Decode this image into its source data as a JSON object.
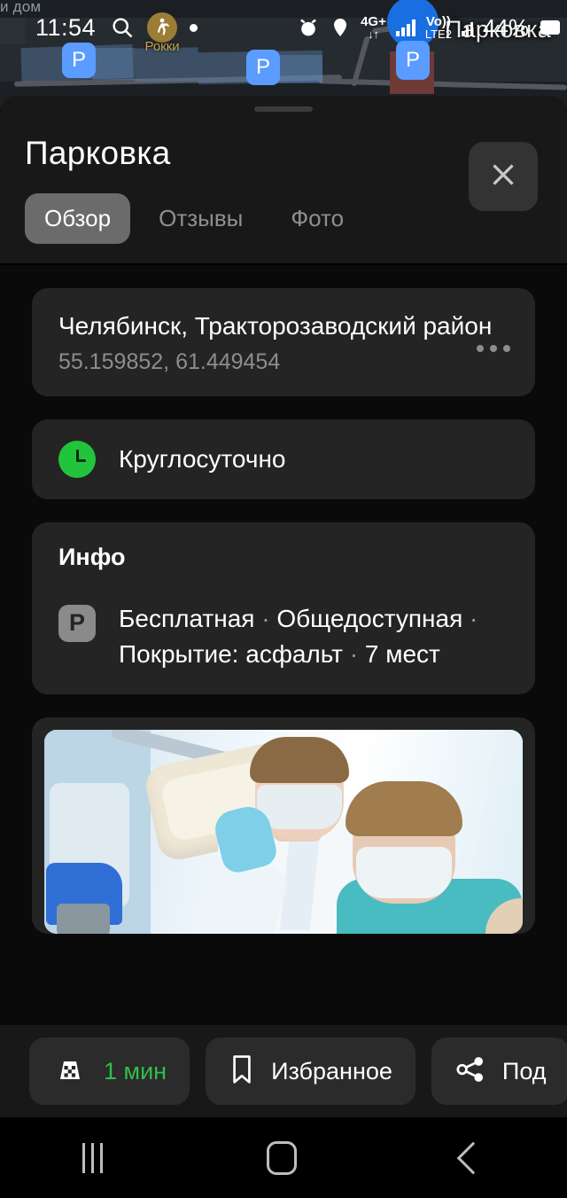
{
  "status_bar": {
    "time": "11:54",
    "search_icon": "search-icon",
    "assistant_icon": "walking-person-icon",
    "assistant_label": "Рокки",
    "recording_dot": "dot-indicator",
    "alarm_icon": "alarm-icon",
    "location_icon": "location-pin-icon",
    "network_type_top": "4G+",
    "network_type_arrows": "↓↑",
    "volte_top": "Vo))",
    "volte_bot": "LTE2",
    "battery_percent": "44%",
    "battery_icon": "battery-icon"
  },
  "map": {
    "label_fragment": "и дом",
    "poi_label": "Парковка",
    "parking_badges": [
      "P",
      "P",
      "P"
    ]
  },
  "sheet": {
    "title": "Парковка",
    "close_icon": "close-icon",
    "tabs": [
      {
        "label": "Обзор",
        "active": true
      },
      {
        "label": "Отзывы",
        "active": false
      },
      {
        "label": "Фото",
        "active": false
      }
    ],
    "address_card": {
      "address": "Челябинск, Тракторозаводский район",
      "coordinates": "55.159852, 61.449454",
      "more_icon": "more-horizontal-icon"
    },
    "hours_card": {
      "icon": "clock-icon",
      "text": "Круглосуточно",
      "icon_color": "#22c43c"
    },
    "info_card": {
      "heading": "Инфо",
      "icon": "parking-p-icon",
      "line1": "Бесплатная",
      "sep1": "·",
      "line2": "Общедоступная",
      "sep2": "·",
      "line3": "Покрытие: асфальт",
      "sep3": "·",
      "line4": "7 мест"
    },
    "photo_card": {
      "alt": "dental-clinic-photo"
    }
  },
  "action_bar": {
    "buttons": [
      {
        "icon": "taxi-icon",
        "label": "1 мин",
        "accent": "#2fbf4a"
      },
      {
        "icon": "bookmark-icon",
        "label": "Избранное"
      },
      {
        "icon": "share-icon",
        "label": "Под"
      }
    ]
  },
  "nav_bar": {
    "recents_icon": "recents-icon",
    "home_icon": "home-icon",
    "back_icon": "back-icon"
  }
}
